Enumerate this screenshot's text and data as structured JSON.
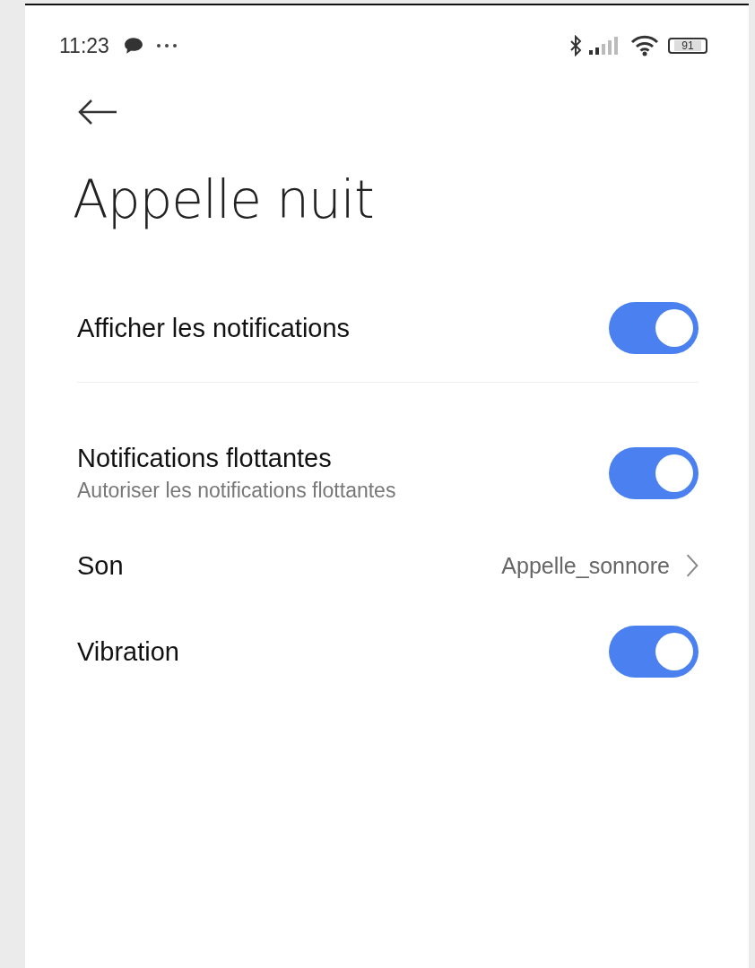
{
  "status_bar": {
    "time": "11:23",
    "battery": "91"
  },
  "title": "Appelle nuit",
  "settings": [
    {
      "kind": "toggle",
      "label": "Afficher les notifications",
      "on": true,
      "divider_after": true
    },
    {
      "kind": "toggle",
      "label": "Notifications flottantes",
      "subtitle": "Autoriser les notifications flottantes",
      "on": true
    },
    {
      "kind": "link",
      "label": "Son",
      "value": "Appelle_sonnore"
    },
    {
      "kind": "toggle",
      "label": "Vibration",
      "on": true
    }
  ]
}
